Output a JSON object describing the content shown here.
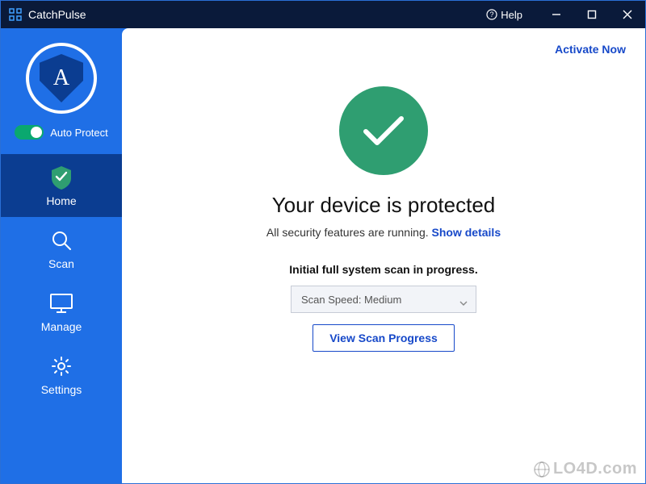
{
  "titlebar": {
    "app_name": "CatchPulse",
    "help_label": "Help"
  },
  "sidebar": {
    "avatar_letter": "A",
    "auto_protect": {
      "label": "Auto Protect",
      "on": true
    },
    "items": [
      {
        "key": "home",
        "label": "Home",
        "active": true
      },
      {
        "key": "scan",
        "label": "Scan",
        "active": false
      },
      {
        "key": "manage",
        "label": "Manage",
        "active": false
      },
      {
        "key": "settings",
        "label": "Settings",
        "active": false
      }
    ]
  },
  "main": {
    "activate_label": "Activate Now",
    "headline": "Your device is protected",
    "subline_prefix": "All security features are running.",
    "show_details_label": "Show details",
    "scan_status": "Initial full system scan in progress.",
    "scan_speed_label": "Scan Speed: Medium",
    "view_progress_label": "View Scan Progress"
  },
  "colors": {
    "brand_blue": "#1f6fe6",
    "dark_blue": "#0b3d91",
    "success_green": "#2f9e71",
    "link_blue": "#1749c9"
  },
  "watermark": "LO4D.com"
}
